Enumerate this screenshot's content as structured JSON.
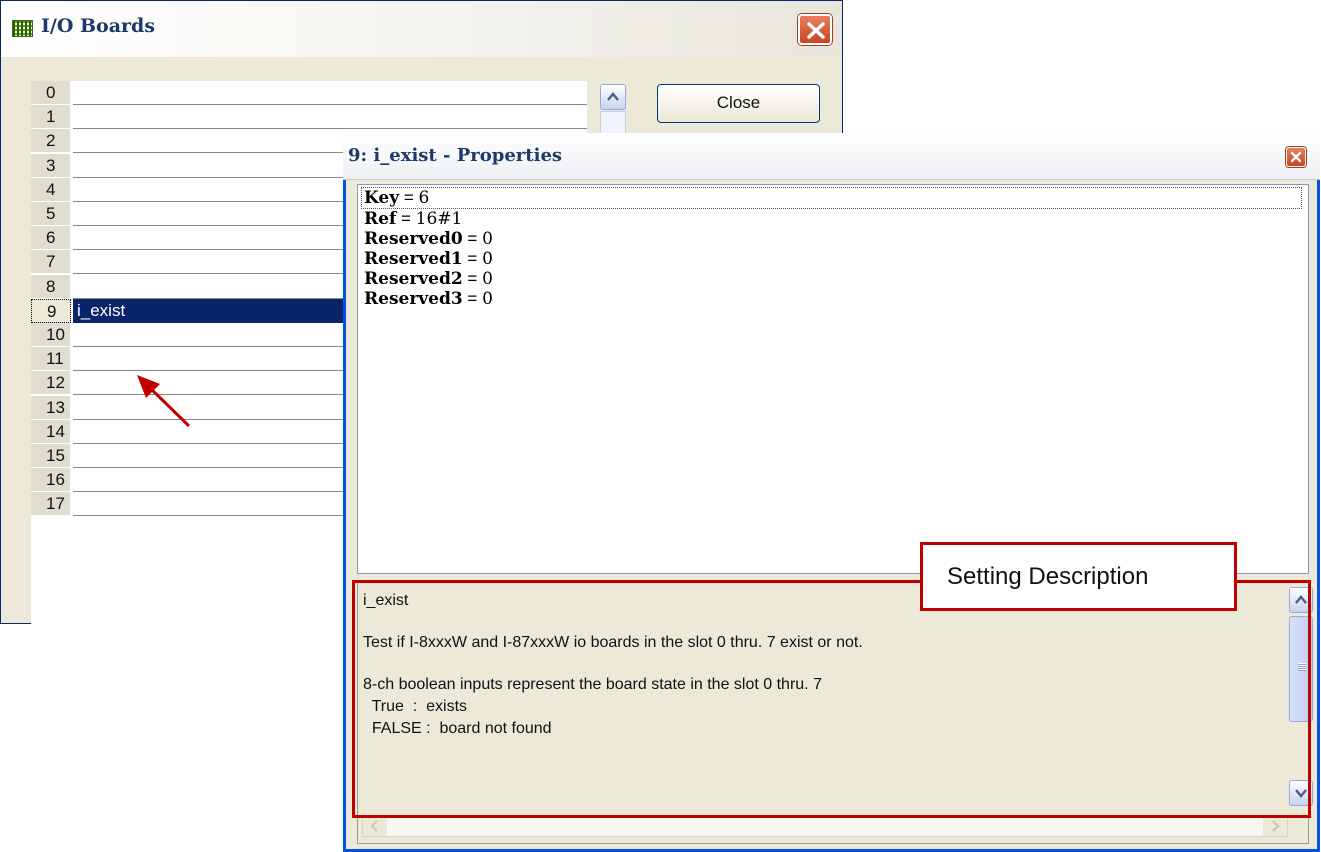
{
  "io_window": {
    "title": "I/O Boards",
    "close_button_label": "Close",
    "rows": [
      {
        "num": "0",
        "value": ""
      },
      {
        "num": "1",
        "value": ""
      },
      {
        "num": "2",
        "value": ""
      },
      {
        "num": "3",
        "value": ""
      },
      {
        "num": "4",
        "value": ""
      },
      {
        "num": "5",
        "value": ""
      },
      {
        "num": "6",
        "value": ""
      },
      {
        "num": "7",
        "value": ""
      },
      {
        "num": "8",
        "value": ""
      },
      {
        "num": "9",
        "value": "i_exist",
        "selected": true
      },
      {
        "num": "10",
        "value": ""
      },
      {
        "num": "11",
        "value": ""
      },
      {
        "num": "12",
        "value": ""
      },
      {
        "num": "13",
        "value": ""
      },
      {
        "num": "14",
        "value": ""
      },
      {
        "num": "15",
        "value": ""
      },
      {
        "num": "16",
        "value": ""
      },
      {
        "num": "17",
        "value": ""
      }
    ]
  },
  "properties_window": {
    "title": "9: i_exist - Properties",
    "properties": [
      {
        "key": "Key",
        "value": "6"
      },
      {
        "key": "Ref",
        "value": "16#1"
      },
      {
        "key": "Reserved0",
        "value": "0"
      },
      {
        "key": "Reserved1",
        "value": "0"
      },
      {
        "key": "Reserved2",
        "value": "0"
      },
      {
        "key": "Reserved3",
        "value": "0"
      }
    ],
    "description": {
      "name": "i_exist",
      "line1": "Test if I-8xxxW and I-87xxxW io boards in the slot 0 thru. 7 exist or not.",
      "line2": "8-ch boolean inputs represent the board state in the slot 0 thru. 7",
      "line3": "  True  :  exists",
      "line4": "  FALSE :  board not found"
    }
  },
  "annotation": {
    "callout_text": "Setting Description",
    "color": "#c00000"
  },
  "colors": {
    "selection": "#0a246a",
    "window_bg": "#ece9d8",
    "frame_blue": "#0055e5"
  }
}
